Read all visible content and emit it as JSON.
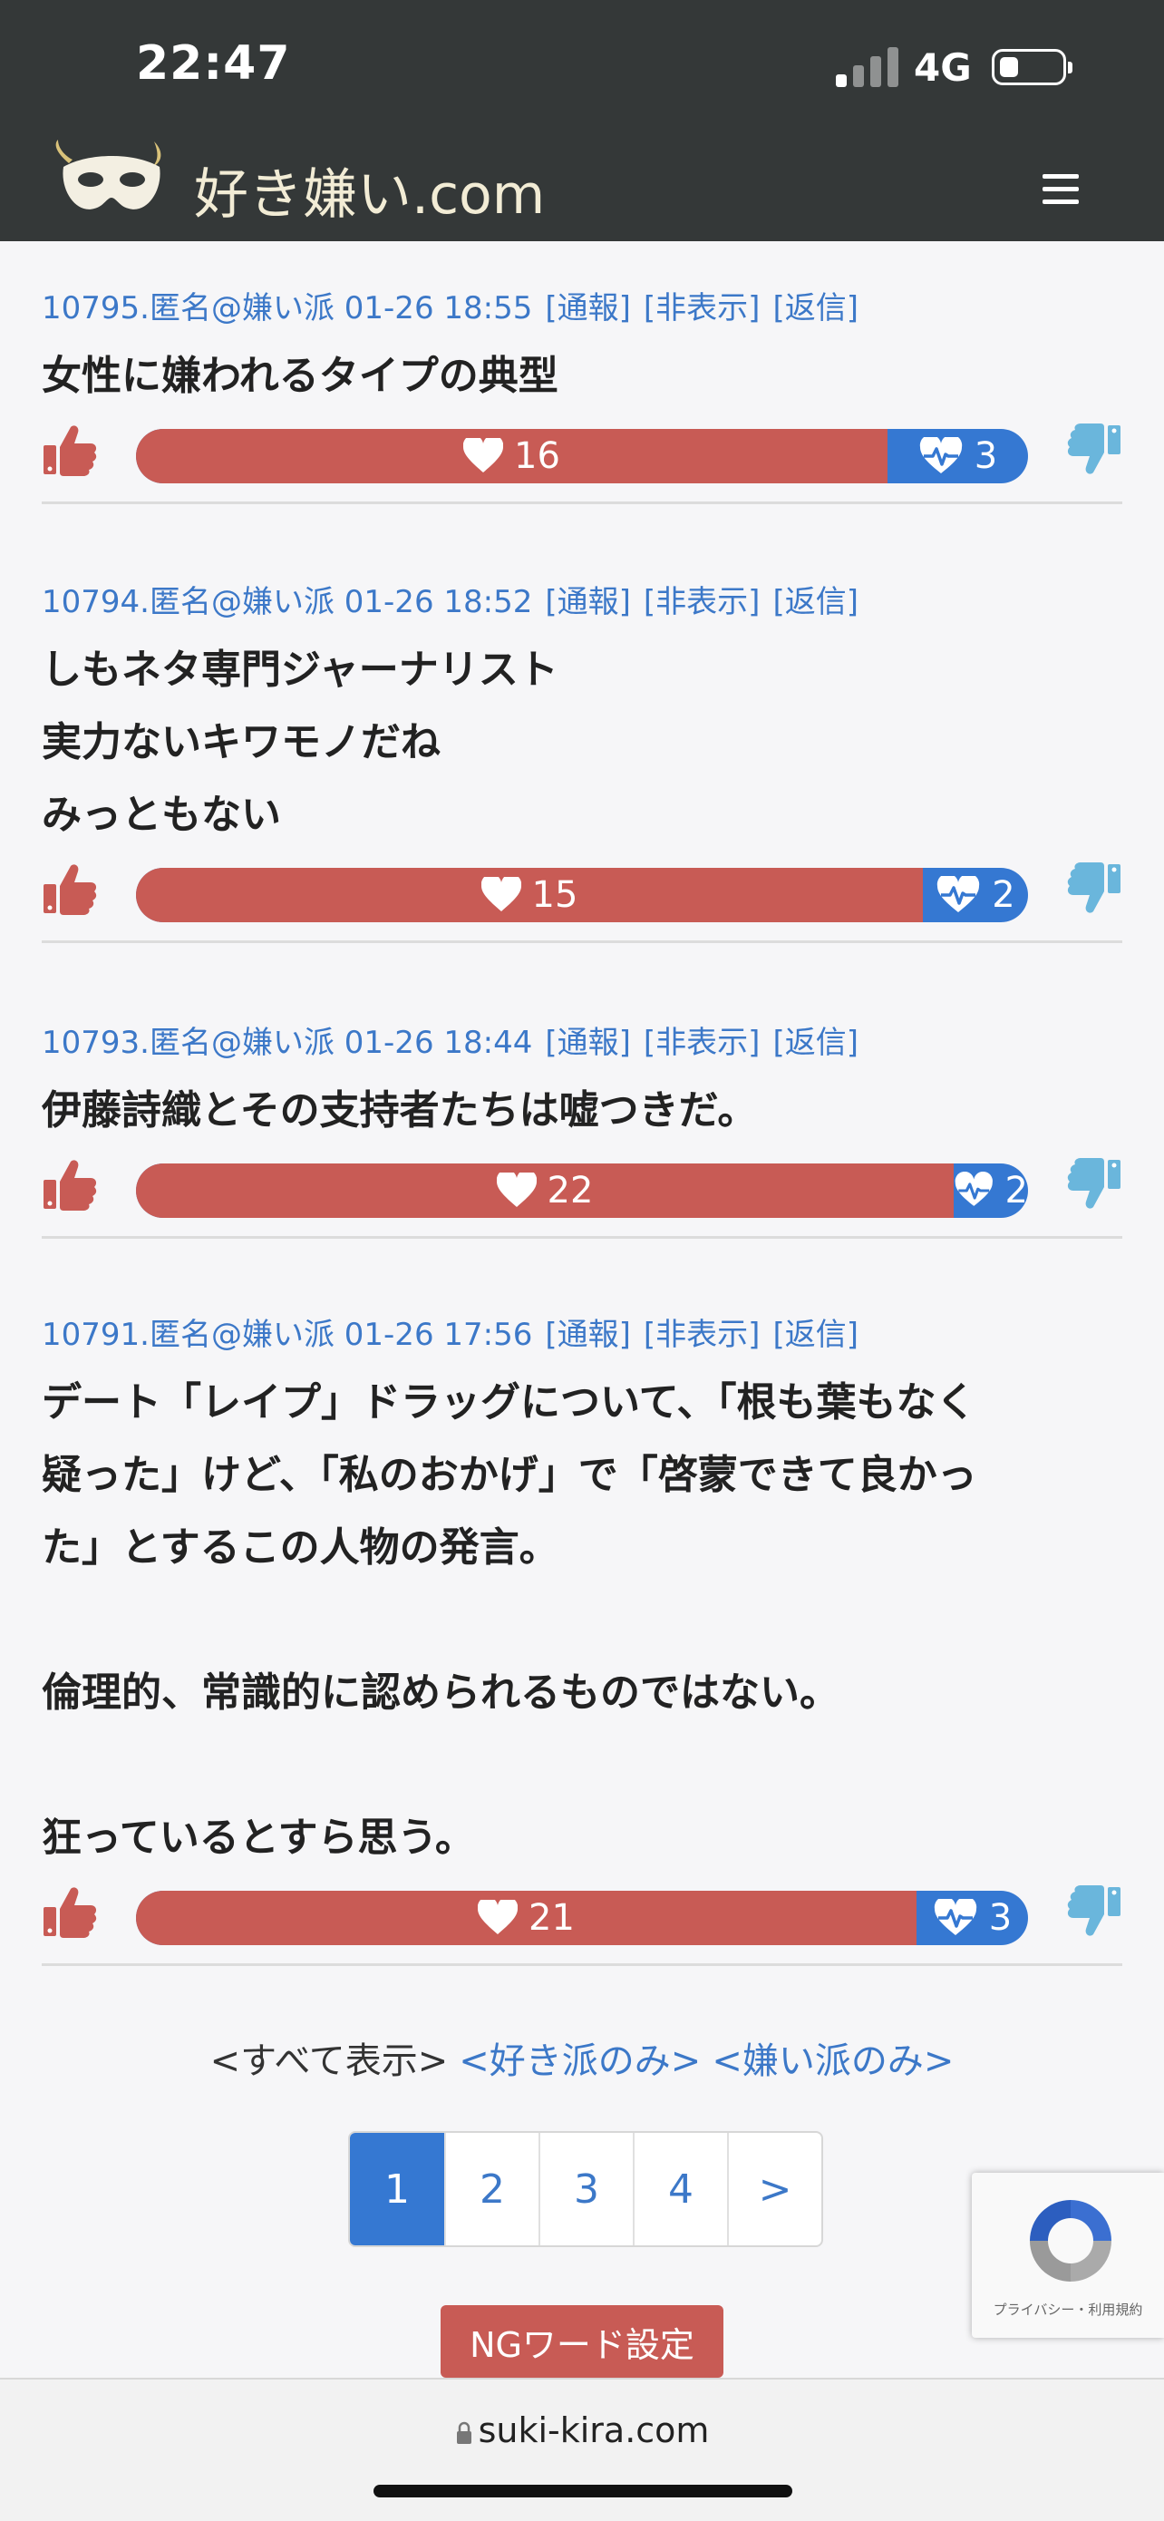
{
  "status_bar": {
    "time": "22:47",
    "network": "4G"
  },
  "header": {
    "site_name": "好き嫌い.com"
  },
  "posts": [
    {
      "meta": "10795.匿名@嫌い派 01-26 18:55",
      "actions": [
        "[通報]",
        "[非表示]",
        "[返信]"
      ],
      "lines": [
        "女性に嫌われるタイプの典型"
      ],
      "likes": 16,
      "dislikes": 3
    },
    {
      "meta": "10794.匿名@嫌い派 01-26 18:52",
      "actions": [
        "[通報]",
        "[非表示]",
        "[返信]"
      ],
      "lines": [
        "しもネタ専門ジャーナリスト",
        "実力ないキワモノだね",
        "みっともない"
      ],
      "likes": 15,
      "dislikes": 2
    },
    {
      "meta": "10793.匿名@嫌い派 01-26 18:44",
      "actions": [
        "[通報]",
        "[非表示]",
        "[返信]"
      ],
      "lines": [
        "伊藤詩織とその支持者たちは嘘つきだ。"
      ],
      "likes": 22,
      "dislikes": 2
    },
    {
      "meta": "10791.匿名@嫌い派 01-26 17:56",
      "actions": [
        "[通報]",
        "[非表示]",
        "[返信]"
      ],
      "lines": [
        "デート「レイプ」ドラッグについて、「根も葉もなく",
        "疑った」けど、「私のおかげ」で「啓蒙できて良かっ",
        "た」とするこの人物の発言。",
        "",
        "倫理的、常識的に認められるものではない。",
        "",
        "狂っているとすら思う。"
      ],
      "likes": 21,
      "dislikes": 3
    }
  ],
  "filters": {
    "all": "<すべて表示>",
    "like_only": "<好き派のみ>",
    "dislike_only": "<嫌い派のみ>"
  },
  "pagination": {
    "pages": [
      "1",
      "2",
      "3",
      "4",
      ">"
    ],
    "current": "1"
  },
  "ng_button": "NGワード設定",
  "recaptcha": {
    "text": "プライバシー・利用規約"
  },
  "browser": {
    "url": "suki-kira.com"
  },
  "colors": {
    "header_bg": "#343838",
    "like": "#c85b55",
    "dislike": "#3578d2",
    "link": "#3c78c8",
    "thumb_down": "#6ab6dc"
  }
}
